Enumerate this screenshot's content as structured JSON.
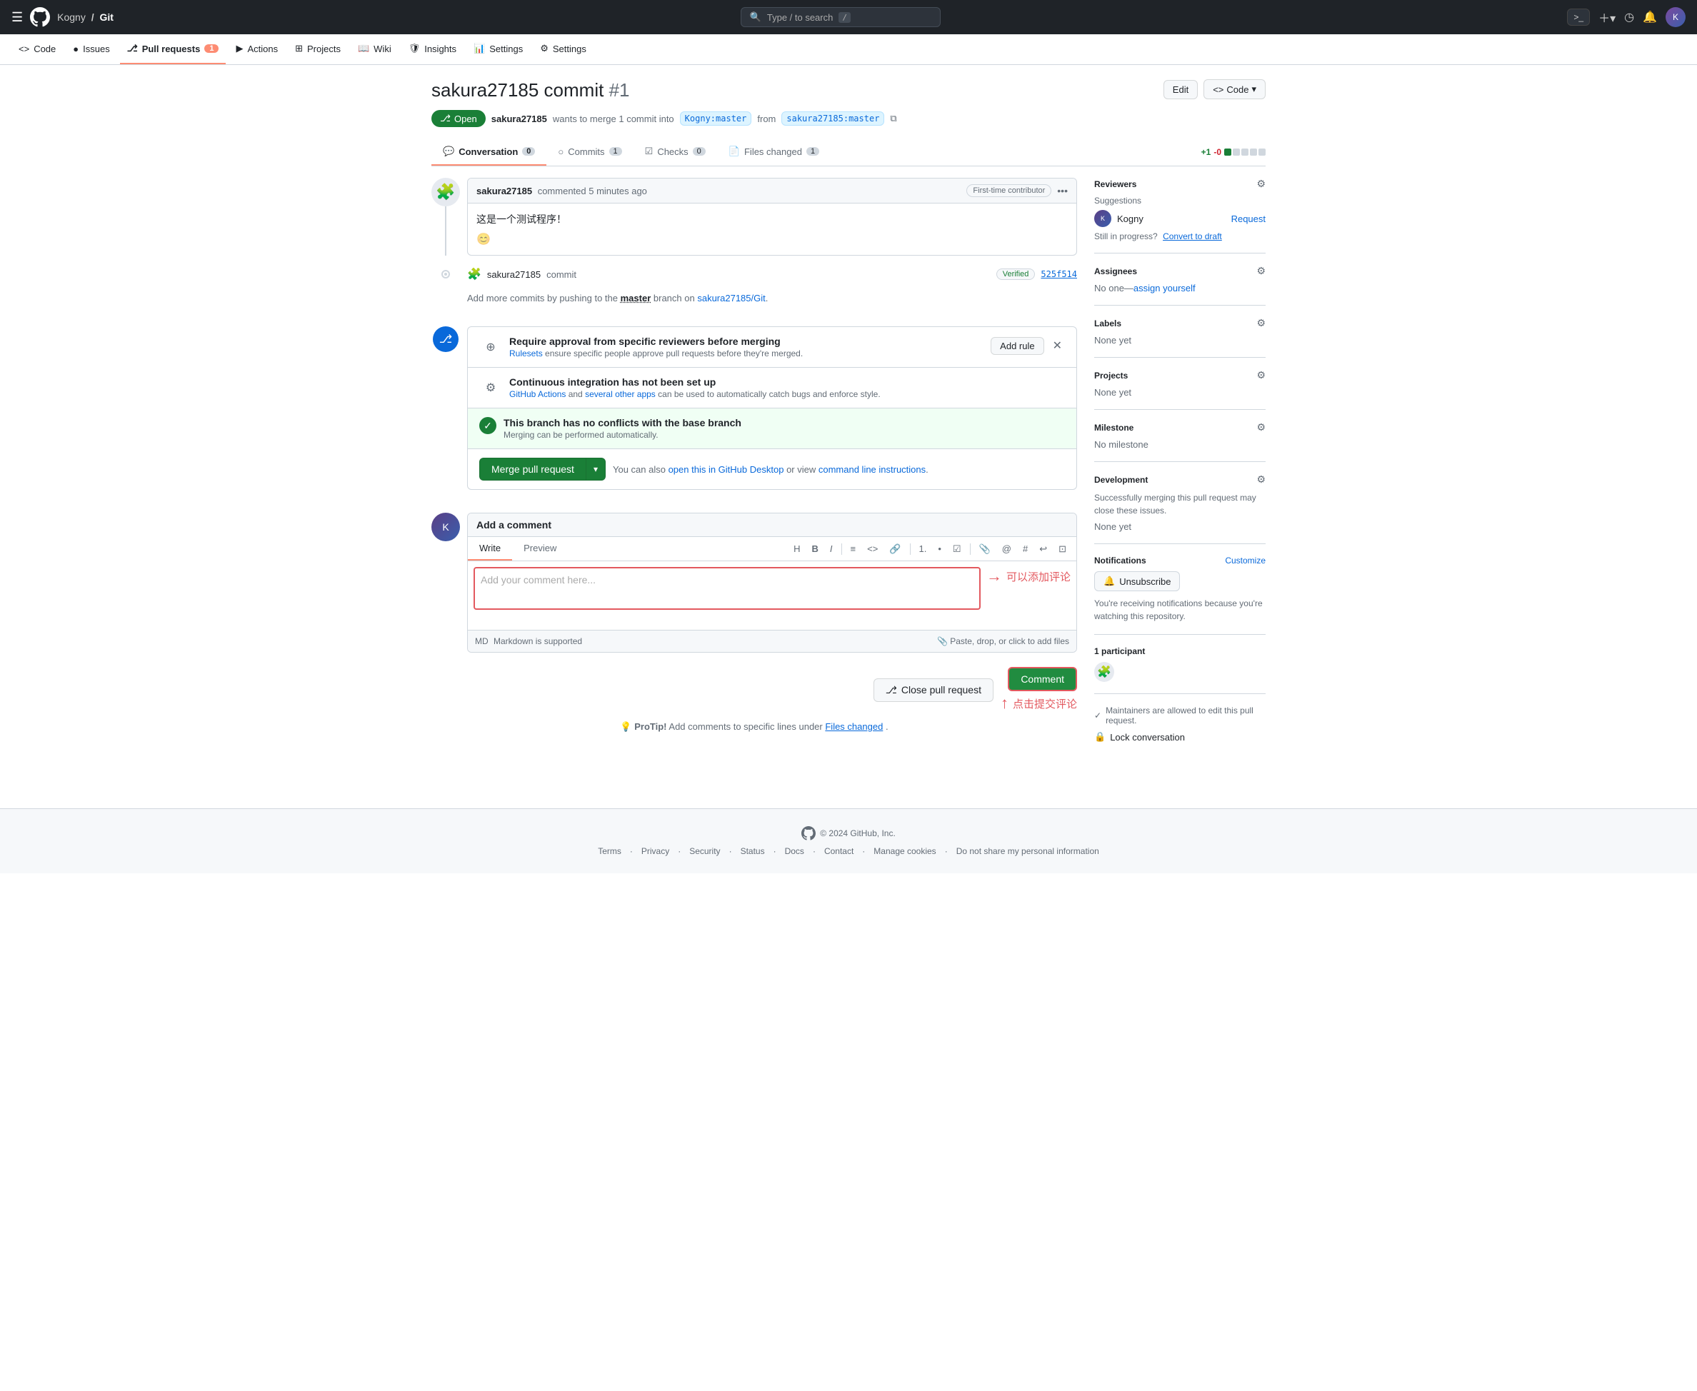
{
  "topNav": {
    "org": "Kogny",
    "repo": "Git",
    "searchPlaceholder": "Type / to search",
    "searchShortcut": "/"
  },
  "repoNav": {
    "items": [
      {
        "id": "code",
        "label": "Code",
        "icon": "<>",
        "badge": null,
        "active": false
      },
      {
        "id": "issues",
        "label": "Issues",
        "icon": "●",
        "badge": null,
        "active": false
      },
      {
        "id": "pull-requests",
        "label": "Pull requests",
        "icon": "⎇",
        "badge": "1",
        "active": true
      },
      {
        "id": "actions",
        "label": "Actions",
        "icon": "▶",
        "badge": null,
        "active": false
      },
      {
        "id": "projects",
        "label": "Projects",
        "icon": "⊞",
        "badge": null,
        "active": false
      },
      {
        "id": "wiki",
        "label": "Wiki",
        "icon": "📖",
        "badge": null,
        "active": false
      },
      {
        "id": "security",
        "label": "Security",
        "icon": "🛡",
        "badge": null,
        "active": false
      },
      {
        "id": "insights",
        "label": "Insights",
        "icon": "📊",
        "badge": null,
        "active": false
      },
      {
        "id": "settings",
        "label": "Settings",
        "icon": "⚙",
        "badge": null,
        "active": false
      }
    ]
  },
  "pr": {
    "title": "sakura27185 commit",
    "number": "#1",
    "editButtonLabel": "Edit",
    "codeButtonLabel": "Code",
    "statusBadge": "Open",
    "author": "sakura27185",
    "description": "wants to merge 1 commit into",
    "targetBranch": "Kogny:master",
    "fromText": "from",
    "sourceBranch": "sakura27185:master",
    "tabs": [
      {
        "id": "conversation",
        "label": "Conversation",
        "badge": "0",
        "active": true
      },
      {
        "id": "commits",
        "label": "Commits",
        "badge": "1",
        "active": false
      },
      {
        "id": "checks",
        "label": "Checks",
        "badge": "0",
        "active": false
      },
      {
        "id": "files-changed",
        "label": "Files changed",
        "badge": "1",
        "active": false
      }
    ],
    "diffStat": {
      "add": "+1",
      "del": "-0"
    }
  },
  "comment": {
    "author": "sakura27185",
    "time": "commented 5 minutes ago",
    "contributorBadge": "First-time contributor",
    "body": "这是一个测试程序！",
    "emoji": "😊"
  },
  "commitRef": {
    "author": "sakura27185",
    "label": "commit",
    "verified": "Verified",
    "hash": "525f514"
  },
  "addMoreCommits": {
    "text1": "Add more commits by pushing to the",
    "branch": "master",
    "text2": "branch on",
    "repoLink": "sakura27185/Git",
    "text3": "."
  },
  "mergeRules": [
    {
      "id": "rulesets",
      "title": "Require approval from specific reviewers before merging",
      "desc1": "Rulesets",
      "desc2": "ensure specific people approve pull requests before they're merged.",
      "actionLabel": "Add rule",
      "hasClose": true
    },
    {
      "id": "ci",
      "title": "Continuous integration has not been set up",
      "desc1": "GitHub Actions",
      "desc2": "and",
      "desc3": "several other apps",
      "desc4": "can be used to automatically catch bugs and enforce style.",
      "hasClose": false
    },
    {
      "id": "no-conflicts",
      "title": "This branch has no conflicts with the base branch",
      "desc": "Merging can be performed automatically.",
      "isSuccess": true,
      "hasClose": false
    }
  ],
  "mergeBtn": {
    "label": "Merge pull request",
    "infoText1": "You can also",
    "openDesktopLink": "open this in GitHub Desktop",
    "infoText2": "or view",
    "commandLineLink": "command line instructions",
    "infoText3": "."
  },
  "commentEditor": {
    "addCommentTitle": "Add a comment",
    "writeTabLabel": "Write",
    "previewTabLabel": "Preview",
    "placeholder": "Add your comment here...",
    "toolbarButtons": [
      "H",
      "B",
      "I",
      "≡",
      "<>",
      "🔗",
      "•",
      "☰",
      "☑",
      "📎",
      "@",
      "↔",
      "↩",
      "⊡"
    ],
    "footerLeft": "Markdown is supported",
    "footerRight": "Paste, drop, or click to add files",
    "annotation": "可以添加评论"
  },
  "bottomActions": {
    "closeLabel": "Close pull request",
    "commentLabel": "Comment",
    "annotation2": "点击提交评论"
  },
  "proTip": {
    "text1": "ProTip!",
    "text2": "Add comments to specific lines under",
    "linkText": "Files changed",
    "text3": "."
  },
  "sidebar": {
    "reviewers": {
      "title": "Reviewers",
      "suggestions": "Suggestions",
      "reviewer": "Kogny",
      "requestLabel": "Request",
      "stillInProgress": "Still in progress?",
      "convertLabel": "Convert to draft"
    },
    "assignees": {
      "title": "Assignees",
      "noOne": "No one—",
      "assignYourself": "assign yourself"
    },
    "labels": {
      "title": "Labels",
      "value": "None yet"
    },
    "projects": {
      "title": "Projects",
      "value": "None yet"
    },
    "milestone": {
      "title": "Milestone",
      "value": "No milestone"
    },
    "development": {
      "title": "Development",
      "desc": "Successfully merging this pull request may close these issues.",
      "value": "None yet"
    },
    "notifications": {
      "title": "Notifications",
      "customizeLabel": "Customize",
      "unsubscribeLabel": "Unsubscribe",
      "infoText": "You're receiving notifications because you're watching this repository."
    },
    "participants": {
      "title": "1 participant"
    },
    "maintainer": {
      "text": "Maintainers are allowed to edit this pull request."
    },
    "lockConversation": "Lock conversation"
  },
  "footer": {
    "copyright": "© 2024 GitHub, Inc.",
    "links": [
      "Terms",
      "Privacy",
      "Security",
      "Status",
      "Docs",
      "Contact",
      "Manage cookies",
      "Do not share my personal information"
    ]
  }
}
